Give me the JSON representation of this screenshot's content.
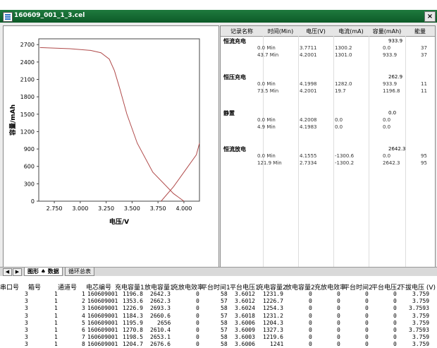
{
  "window": {
    "title": "160609_001_1_3.cel",
    "close_label": "×"
  },
  "chart_data": {
    "type": "line",
    "xlabel": "电压/V",
    "ylabel": "容量/mAh",
    "xlim": [
      2.6,
      4.15
    ],
    "ylim": [
      0,
      2800
    ],
    "xticks": [
      "2.750",
      "3.000",
      "3.250",
      "3.500",
      "3.750",
      "4.000"
    ],
    "xtick_values": [
      2.75,
      3.0,
      3.25,
      3.5,
      3.75,
      4.0
    ],
    "yticks": [
      "0",
      "300",
      "600",
      "900",
      "1200",
      "1500",
      "1800",
      "2100",
      "2400",
      "2700"
    ],
    "ytick_values": [
      0,
      300,
      600,
      900,
      1200,
      1500,
      1800,
      2100,
      2400,
      2700
    ],
    "series": [
      {
        "color": "#b04a4a",
        "points": [
          [
            2.61,
            2650
          ],
          [
            2.9,
            2630
          ],
          [
            3.1,
            2600
          ],
          [
            3.2,
            2560
          ],
          [
            3.28,
            2450
          ],
          [
            3.33,
            2250
          ],
          [
            3.38,
            1950
          ],
          [
            3.45,
            1500
          ],
          [
            3.55,
            1000
          ],
          [
            3.7,
            500
          ],
          [
            3.9,
            130
          ],
          [
            4.0,
            0
          ]
        ]
      },
      {
        "color": "#b04a4a",
        "points": [
          [
            3.78,
            0
          ],
          [
            3.9,
            250
          ],
          [
            4.02,
            550
          ],
          [
            4.12,
            800
          ],
          [
            4.15,
            1000
          ]
        ]
      }
    ]
  },
  "grid": {
    "headers": [
      "记录名称",
      "时间(Min)",
      "电压(V)",
      "电流(mA)",
      "容量(mAh)",
      "能量"
    ],
    "sections": [
      {
        "name": "恒流充电",
        "total": "933.9",
        "rows": [
          [
            "0.0 Min",
            "3.7711",
            "1300.2",
            "0.0",
            "37"
          ],
          [
            "43.7 Min",
            "4.2001",
            "1301.0",
            "933.9",
            "37"
          ]
        ]
      },
      {
        "name": "恒压充电",
        "total": "262.9",
        "rows": [
          [
            "0.0 Min",
            "4.1998",
            "1282.0",
            "933.9",
            "11"
          ],
          [
            "73.5 Min",
            "4.2001",
            "19.7",
            "1196.8",
            "11"
          ]
        ]
      },
      {
        "name": "静置",
        "total": "0.0",
        "rows": [
          [
            "0.0 Min",
            "4.2008",
            "0.0",
            "0.0",
            ""
          ],
          [
            "4.9 Min",
            "4.1983",
            "0.0",
            "0.0",
            ""
          ]
        ]
      },
      {
        "name": "恒流放电",
        "total": "2642.3",
        "rows": [
          [
            "0.0 Min",
            "4.1555",
            "-1300.6",
            "0.0",
            "95"
          ],
          [
            "121.9 Min",
            "2.7334",
            "-1300.2",
            "2642.3",
            "95"
          ]
        ]
      }
    ]
  },
  "tabs": {
    "nav_left": "◀",
    "nav_right": "▶",
    "items": [
      "图形 ♠ 数据",
      "循环总表"
    ]
  },
  "table": {
    "headers": [
      "串口号",
      "箱号",
      "通道号",
      "电芯编号",
      "充电容量1",
      "放电容量1",
      "充放电效率",
      "平台时间1",
      "平台电压1",
      "充电容量2",
      "放电容量2",
      "充放电效率",
      "平台时间2",
      "平台电压2",
      "下拔电压 (V)"
    ],
    "rows": [
      [
        "3",
        "1",
        "1",
        "160609001",
        "1196.8",
        "2642.3",
        "0",
        "58",
        "3.6012",
        "1231.9",
        "0",
        "0",
        "0",
        "0",
        "3.759"
      ],
      [
        "3",
        "1",
        "2",
        "160609001",
        "1353.6",
        "2662.3",
        "0",
        "57",
        "3.6012",
        "1226.7",
        "0",
        "0",
        "0",
        "0",
        "3.759"
      ],
      [
        "3",
        "1",
        "3",
        "160609001",
        "1226.9",
        "2693.3",
        "0",
        "58",
        "3.6024",
        "1254.3",
        "0",
        "0",
        "0",
        "0",
        "3.7593"
      ],
      [
        "3",
        "1",
        "4",
        "160609001",
        "1184.3",
        "2660.6",
        "0",
        "57",
        "3.6018",
        "1231.2",
        "0",
        "0",
        "0",
        "0",
        "3.759"
      ],
      [
        "3",
        "1",
        "5",
        "160609001",
        "1195.9",
        "2656",
        "0",
        "58",
        "3.6006",
        "1204.3",
        "0",
        "0",
        "0",
        "0",
        "3.759"
      ],
      [
        "3",
        "1",
        "6",
        "160609001",
        "1270.8",
        "2610.4",
        "0",
        "57",
        "3.6009",
        "1327.3",
        "0",
        "0",
        "0",
        "0",
        "3.7593"
      ],
      [
        "3",
        "1",
        "7",
        "160609001",
        "1198.5",
        "2653.1",
        "0",
        "58",
        "3.6003",
        "1219.6",
        "0",
        "0",
        "0",
        "0",
        "3.759"
      ],
      [
        "3",
        "1",
        "8",
        "160609001",
        "1204.7",
        "2676.6",
        "0",
        "58",
        "3.6006",
        "1241",
        "0",
        "0",
        "0",
        "0",
        "3.759"
      ]
    ]
  }
}
